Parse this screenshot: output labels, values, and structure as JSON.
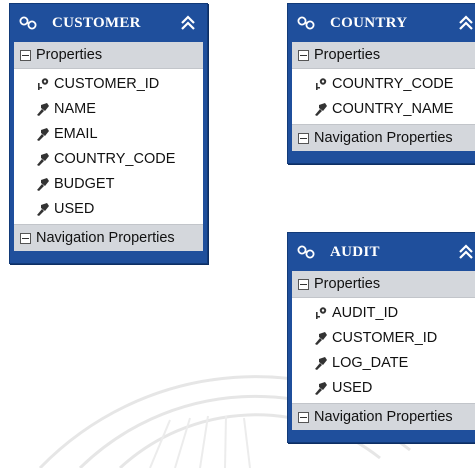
{
  "section_labels": {
    "properties": "Properties",
    "navigation": "Navigation Properties"
  },
  "entities": [
    {
      "name": "CUSTOMER",
      "properties": [
        {
          "label": "CUSTOMER_ID",
          "icon": "key-icon"
        },
        {
          "label": "NAME",
          "icon": "property-icon"
        },
        {
          "label": "EMAIL",
          "icon": "property-icon"
        },
        {
          "label": "COUNTRY_CODE",
          "icon": "property-icon"
        },
        {
          "label": "BUDGET",
          "icon": "property-icon"
        },
        {
          "label": "USED",
          "icon": "property-icon"
        }
      ]
    },
    {
      "name": "COUNTRY",
      "properties": [
        {
          "label": "COUNTRY_CODE",
          "icon": "key-icon"
        },
        {
          "label": "COUNTRY_NAME",
          "icon": "property-icon"
        }
      ]
    },
    {
      "name": "AUDIT",
      "properties": [
        {
          "label": "AUDIT_ID",
          "icon": "key-icon"
        },
        {
          "label": "CUSTOMER_ID",
          "icon": "property-icon"
        },
        {
          "label": "LOG_DATE",
          "icon": "property-icon"
        },
        {
          "label": "USED",
          "icon": "property-icon"
        }
      ]
    }
  ],
  "colors": {
    "entity_header": "#1f4f9c",
    "section_header": "#d4d7dc",
    "body": "#ffffff"
  }
}
